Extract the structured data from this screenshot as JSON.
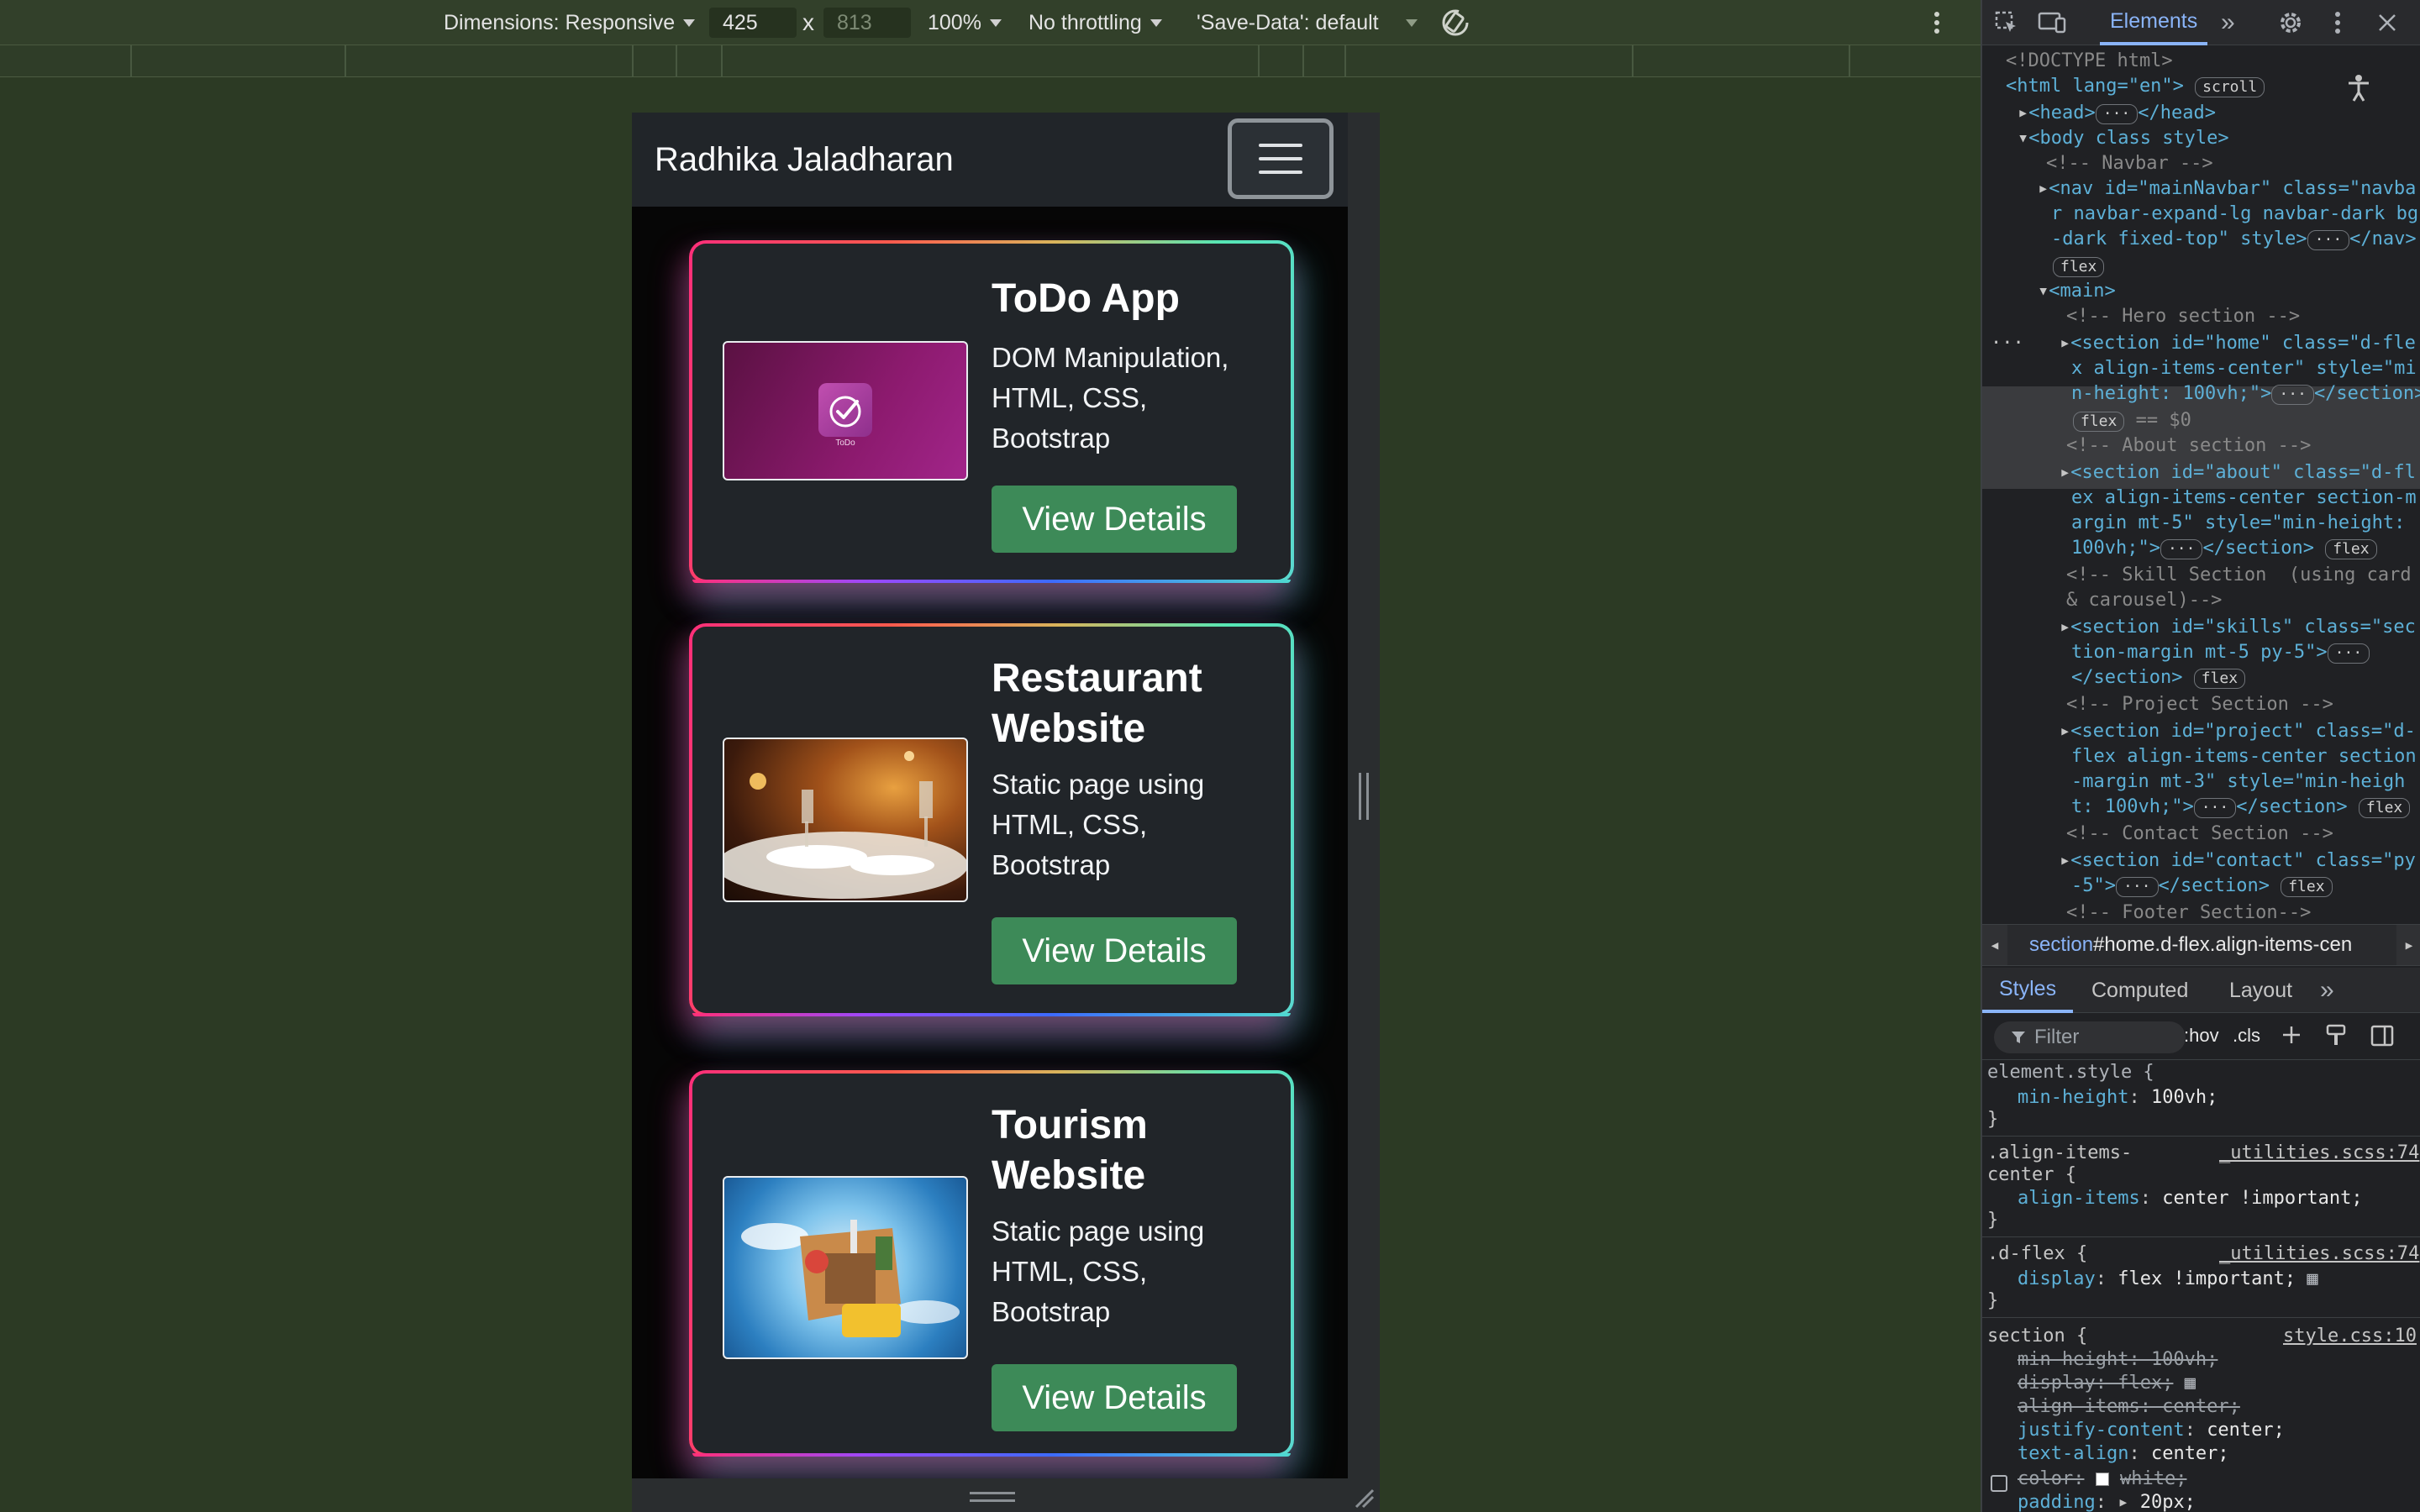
{
  "device_toolbar": {
    "dimensions_label": "Dimensions: Responsive",
    "width": "425",
    "height": "813",
    "times": "x",
    "zoom": "100%",
    "throttling": "No throttling",
    "save_data": "'Save-Data': default"
  },
  "site": {
    "brand": "Radhika Jaladharan",
    "button_label": "View Details",
    "projects": [
      {
        "title": "ToDo App",
        "desc": "DOM Manipulation, HTML, CSS, Bootstrap",
        "thumb_label": "ToDo"
      },
      {
        "title": "Restaurant Website",
        "desc": "Static page using HTML, CSS, Bootstrap"
      },
      {
        "title": "Tourism Website",
        "desc": "Static page using HTML, CSS, Bootstrap"
      }
    ]
  },
  "devtools": {
    "tabs": {
      "elements": "Elements",
      "more": "»"
    },
    "dom": {
      "doctype": "<!DOCTYPE html>",
      "html_open": "<html lang=\"en\">",
      "scroll_pill": "scroll",
      "head": "<head>",
      "head_close": "</head>",
      "body_open": "<body class style>",
      "c_navbar": "<!-- Navbar -->",
      "nav_1": "<nav id=\"mainNavbar\" class=\"navba",
      "nav_2": "r navbar-expand-lg navbar-dark bg",
      "nav_3": "-dark fixed-top\" style>",
      "nav_close": "</nav>",
      "flex": "flex",
      "main_open": "<main>",
      "c_hero": "<!-- Hero section -->",
      "home_1": "<section id=\"home\" class=\"d-fle",
      "home_2": "x align-items-center\" style=\"mi",
      "home_3": "n-height: 100vh;\">",
      "section_close": "</section>",
      "eq": "== $0",
      "c_about": "<!-- About section -->",
      "about_1": "<section id=\"about\" class=\"d-fl",
      "about_2": "ex align-items-center section-m",
      "about_3": "argin mt-5\" style=\"min-height:",
      "about_4": "100vh;\">",
      "c_skill_1": "<!-- Skill Section  (using card",
      "c_skill_2": "& carousel)-->",
      "skills_1": "<section id=\"skills\" class=\"sec",
      "skills_2": "tion-margin mt-5 py-5\">",
      "c_project": "<!-- Project Section -->",
      "project_1": "<section id=\"project\" class=\"d-",
      "project_2": "flex align-items-center section",
      "project_3": "-margin mt-3\" style=\"min-heigh",
      "project_4": "t: 100vh;\">",
      "c_contact": "<!-- Contact Section -->",
      "contact_1": "<section id=\"contact\" class=\"py",
      "contact_2": "-5\">",
      "c_footer": "<!-- Footer Section-->"
    },
    "breadcrumb": {
      "tag": "section",
      "rest": "#home.d-flex.align-items-cen"
    },
    "sub_tabs": {
      "styles": "Styles",
      "computed": "Computed",
      "layout": "Layout",
      "more": "»"
    },
    "filter_placeholder": "Filter",
    "hov": ":hov",
    "cls": ".cls",
    "rules": {
      "element_style": "element.style {",
      "r1_prop": "min-height",
      "r1_val": "100vh;",
      "close": "}",
      "align_sel_1": ".align-items-",
      "align_sel_2": "center {",
      "align_src": "_utilities.scss:74",
      "align_prop": "align-items",
      "align_val": "center !important;",
      "dflex_sel": ".d-flex {",
      "dflex_src": "_utilities.scss:74",
      "dflex_prop": "display",
      "dflex_val": "flex !important;",
      "section_sel": "section {",
      "section_src": "style.css:10",
      "s1": "min-height: 100vh;",
      "s2": "display: flex;",
      "s3": "align-items: center;",
      "s4_prop": "justify-content",
      "s4_val": "center;",
      "s5_prop": "text-align",
      "s5_val": "center;",
      "s6": "color:",
      "s6_val": "white;",
      "s7_prop": "padding",
      "s7_val": "20px;"
    },
    "colors": {
      "accent": "#8ab4f8",
      "button_green": "#3d8a58",
      "background": "#202124"
    }
  }
}
